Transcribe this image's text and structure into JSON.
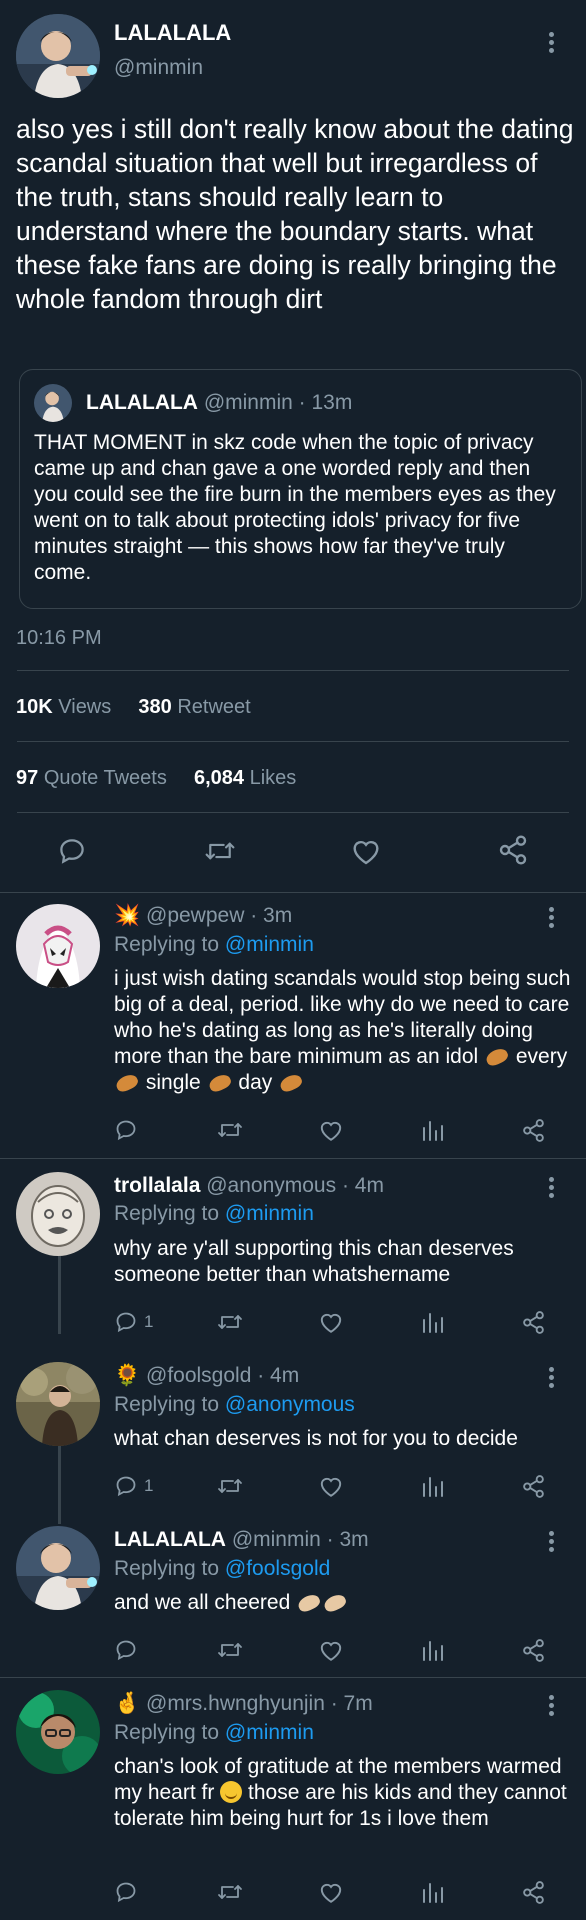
{
  "main_tweet": {
    "display_name": "LALALALA",
    "handle": "@minmin",
    "text": "also yes i still don't really know about the dating scandal situation that well but irregardless of the truth, stans should really learn to understand where the boundary starts. what these fake fans are doing is really bringing the whole fandom through dirt",
    "quote": {
      "display_name": "LALALALA",
      "meta": "@minmin · 13m",
      "text": "THAT MOMENT in skz code when the topic of privacy came up and chan gave a one worded reply and then you could see the fire burn in the members eyes as they went on to talk about protecting idols' privacy for five minutes straight — this shows how far they've truly come."
    },
    "time": "10:16 PM",
    "stats": {
      "views_count": "10K",
      "views_label": "Views",
      "retweet_count": "380",
      "retweet_label": "Retweet",
      "quote_count": "97",
      "quote_label": "Quote Tweets",
      "likes_count": "6,084",
      "likes_label": "Likes"
    }
  },
  "replies": [
    {
      "name_emoji": "💥",
      "meta": "@pewpew · 3m",
      "replying_prefix": "Replying to",
      "replying_to": "@minmin",
      "text_parts": [
        "i just wish dating scandals would stop being such big of a deal, period. like why do we need to care who he's dating as long as he's literally doing more than the bare minimum as an idol",
        "every",
        "single",
        "day"
      ],
      "reply_count": ""
    },
    {
      "display_name": "trollalala",
      "meta": "@anonymous · 4m",
      "replying_prefix": "Replying to",
      "replying_to": "@minmin",
      "text": "why are y'all supporting this chan deserves someone better than whatshername",
      "reply_count": "1"
    },
    {
      "name_emoji": "🌻",
      "meta": "@foolsgold · 4m",
      "replying_prefix": "Replying to",
      "replying_to": "@anonymous",
      "text": "what chan deserves is not for you to decide",
      "reply_count": "1"
    },
    {
      "display_name": "LALALALA",
      "meta": "@minmin · 3m",
      "replying_prefix": "Replying to",
      "replying_to": "@foolsgold",
      "text": "and we all cheered",
      "reply_count": ""
    },
    {
      "name_emoji": "🤞",
      "meta": "@mrs.hwnghyunjin · 7m",
      "replying_prefix": "Replying to",
      "replying_to": "@minmin",
      "text_parts": [
        "chan's look of gratitude at the members warmed my heart fr",
        "those are his kids and they cannot tolerate him being hurt for 1s i love them"
      ],
      "reply_count": ""
    }
  ],
  "colors": {
    "background": "#15202b",
    "muted": "#8899a6",
    "accent": "#1d9bf0",
    "divider": "#38444d"
  },
  "icons": [
    "reply-icon",
    "retweet-icon",
    "like-icon",
    "share-icon",
    "views-icon",
    "more-icon"
  ]
}
